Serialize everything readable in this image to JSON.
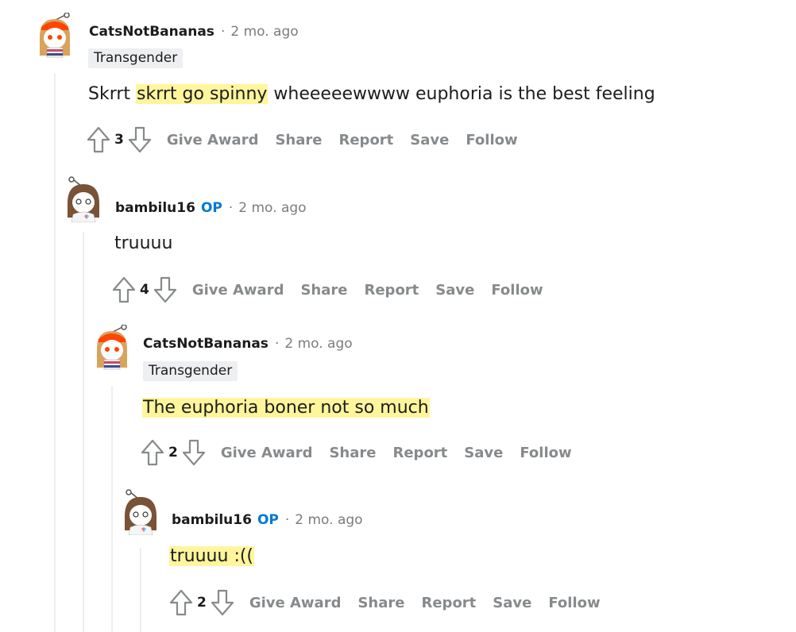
{
  "comments": [
    {
      "username": "CatsNotBananas",
      "op_badge": "",
      "separator": "·",
      "time": "2 mo. ago",
      "flair": "Transgender",
      "text_plain_before": "Skrrt ",
      "text_highlight": "skrrt go spinny",
      "text_plain_after": " wheeeeewwww euphoria is the best feeling",
      "score": "3",
      "actions": [
        "Give Award",
        "Share",
        "Report",
        "Save",
        "Follow"
      ]
    },
    {
      "username": "bambilu16",
      "op_badge": "OP",
      "separator": "·",
      "time": "2 mo. ago",
      "text": "truuuu",
      "score": "4",
      "actions": [
        "Give Award",
        "Share",
        "Report",
        "Save",
        "Follow"
      ]
    },
    {
      "username": "CatsNotBananas",
      "separator": "·",
      "time": "2 mo. ago",
      "flair": "Transgender",
      "text": "The euphoria boner not so much",
      "score": "2",
      "actions": [
        "Give Award",
        "Share",
        "Report",
        "Save",
        "Follow"
      ]
    },
    {
      "username": "bambilu16",
      "op_badge": "OP",
      "separator": "·",
      "time": "2 mo. ago",
      "text": "truuuu :((",
      "score": "2",
      "actions": [
        "Give Award",
        "Share",
        "Report",
        "Save",
        "Follow"
      ]
    }
  ],
  "colors": {
    "op": "#0079d3",
    "meta": "#7c7c7c",
    "action": "#878a8c",
    "highlight": "#fff59d",
    "thread_line": "#edeff1"
  }
}
